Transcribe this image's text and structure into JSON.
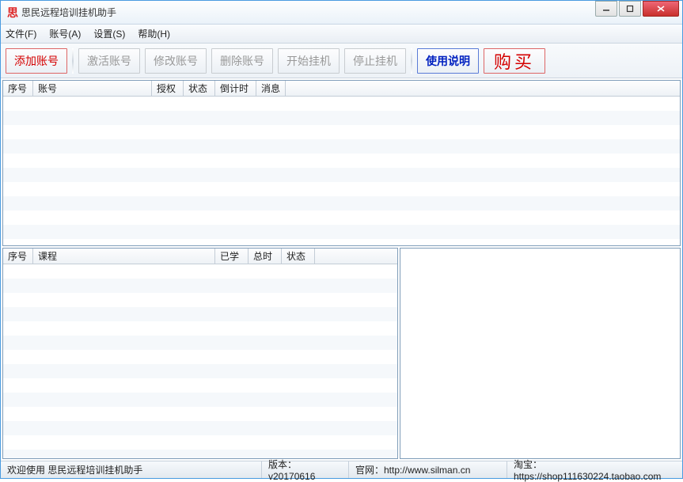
{
  "titlebar": {
    "icon_text": "思",
    "title": "思民远程培训挂机助手"
  },
  "menu": {
    "file": "文件(F)",
    "account": "账号(A)",
    "settings": "设置(S)",
    "help": "帮助(H)"
  },
  "toolbar": {
    "add_account": "添加账号",
    "activate_account": "激活账号",
    "modify_account": "修改账号",
    "delete_account": "删除账号",
    "start_hang": "开始挂机",
    "stop_hang": "停止挂机",
    "instructions": "使用说明",
    "buy": "购买"
  },
  "top_table": {
    "col_index": "序号",
    "col_account": "账号",
    "col_auth": "授权",
    "col_status": "状态",
    "col_countdown": "倒计时",
    "col_message": "消息"
  },
  "bottom_table": {
    "col_index": "序号",
    "col_course": "课程",
    "col_learned": "已学",
    "col_total": "总时",
    "col_status": "状态"
  },
  "status": {
    "welcome": "欢迎使用 思民远程培训挂机助手",
    "version": "版本：v20170616",
    "site": "官网：http://www.silman.cn",
    "shop": "淘宝：https://shop111630224.taobao.com"
  }
}
